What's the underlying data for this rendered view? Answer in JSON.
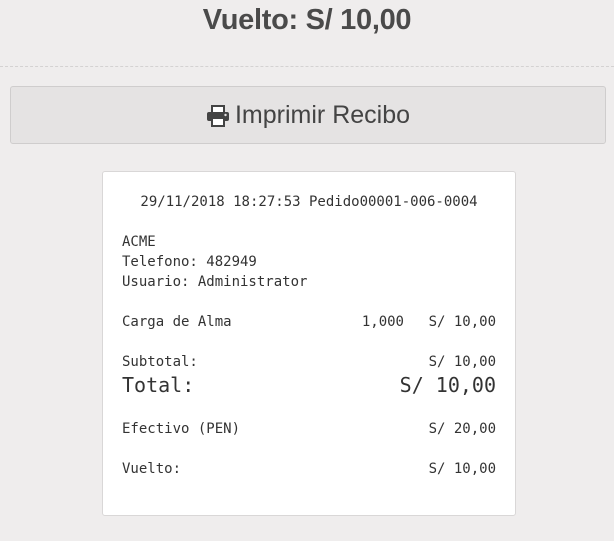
{
  "header": {
    "change_text": "Vuelto: S/ 10,00"
  },
  "print_button": {
    "label": "Imprimir Recibo",
    "icon": "printer-icon"
  },
  "receipt": {
    "datetime": "29/11/2018 18:27:53",
    "order": "Pedido00001-006-0004",
    "company": "ACME",
    "phone": "Telefono: 482949",
    "user": "Usuario: Administrator",
    "items": [
      {
        "name": "Carga de Alma",
        "quantity": "1,000",
        "amount": "S/ 10,00"
      }
    ],
    "subtotal_label": "Subtotal:",
    "subtotal_value": "S/ 10,00",
    "total_label": "Total:",
    "total_value": "S/ 10,00",
    "payment_label": "Efectivo (PEN)",
    "payment_value": "S/ 20,00",
    "change_label": "Vuelto:",
    "change_value": "S/ 10,00"
  }
}
